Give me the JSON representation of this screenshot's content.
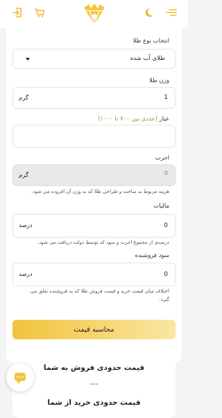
{
  "header": {
    "icons": [
      "logout-icon",
      "cart-icon",
      "logo-icon",
      "moon-icon",
      "menu-icon"
    ],
    "accent_color": "#f5c542"
  },
  "form": {
    "gold_type": {
      "label": "انتخاب نوع طلا",
      "value": "طلای آب شده"
    },
    "weight": {
      "label": "وزن طلا",
      "value": "1",
      "unit": "گرم"
    },
    "purity": {
      "label": "عیار",
      "hint": "(عددی بین ۷۰۰ تا ۱۰۰۰)",
      "value": ""
    },
    "wage": {
      "label": "اجرت",
      "value": "0",
      "unit": "گرم",
      "note": "هزینه مربوط به ساخت و طراحی طلا که به وزن آن افزوده می شود."
    },
    "tax": {
      "label": "مالیات",
      "value": "0",
      "unit": "درصد",
      "note": "درصدی از مجموع اجرت و سود که توسط دولت دریافت می شود."
    },
    "profit": {
      "label": "سود فروشنده",
      "value": "0",
      "unit": "درصد",
      "note_line1": "اختلاف میان قیمت خرید و قیمت فروش طلا که به فروشنده تعلق می",
      "note_line2": "گیرد."
    }
  },
  "calculate_button": "محاسبه قیمت",
  "results": {
    "sell_title": "قیمت حدودی فروش به شما",
    "sell_value": "---",
    "buy_title": "قیمت حدودی خرید از شما"
  },
  "chat": {
    "icon": "chat-icon"
  }
}
